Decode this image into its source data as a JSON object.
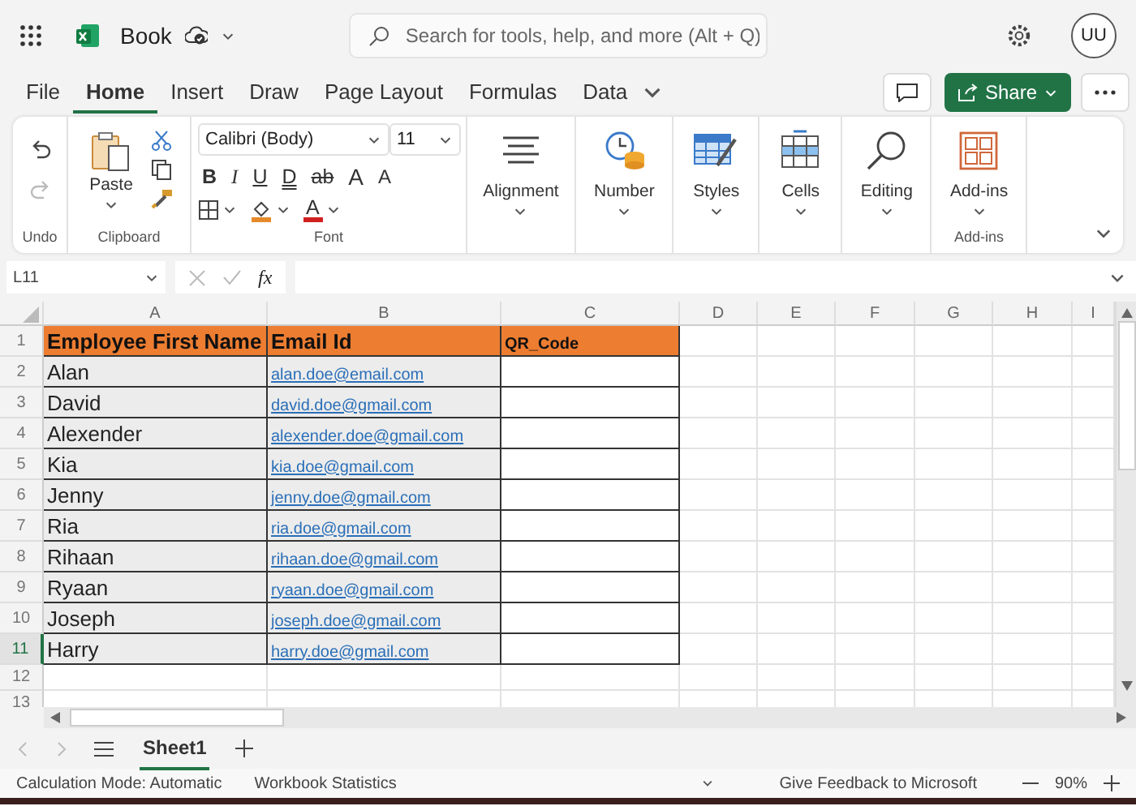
{
  "app_bar": {
    "title": "Book",
    "search": {
      "placeholder": "Search for tools, help, and more (Alt + Q)"
    },
    "avatar": "UU"
  },
  "menu_tabs": [
    {
      "label": "File",
      "selected": false
    },
    {
      "label": "Home",
      "selected": true
    },
    {
      "label": "Insert",
      "selected": false
    },
    {
      "label": "Draw",
      "selected": false
    },
    {
      "label": "Page Layout",
      "selected": false
    },
    {
      "label": "Formulas",
      "selected": false
    },
    {
      "label": "Data",
      "selected": false
    }
  ],
  "share_button": "Share",
  "ribbon": {
    "undo": {
      "label": "Undo",
      "buttons": [
        {
          "kind": "undo",
          "disabled": false
        },
        {
          "kind": "redo",
          "disabled": true
        }
      ]
    },
    "clipboard": {
      "label": "Clipboard",
      "paste": "Paste"
    },
    "font": {
      "label": "Font",
      "family": "Calibri (Body)",
      "size": "11",
      "format_buttons": [
        {
          "kind": "bold",
          "label": "B"
        },
        {
          "kind": "italic",
          "label": "I"
        },
        {
          "kind": "underline",
          "label": "U"
        },
        {
          "kind": "double_underline",
          "label": "D"
        },
        {
          "kind": "strikethrough",
          "label": "ab"
        },
        {
          "kind": "grow",
          "label": "A"
        },
        {
          "kind": "shrink",
          "label": "A"
        }
      ],
      "font_color": "A"
    },
    "commands": [
      {
        "kind": "alignment",
        "label": "Alignment"
      },
      {
        "kind": "number",
        "label": "Number"
      },
      {
        "kind": "styles",
        "label": "Styles"
      },
      {
        "kind": "cells",
        "label": "Cells"
      },
      {
        "kind": "editing",
        "label": "Editing"
      },
      {
        "kind": "addins",
        "label": "Add-ins",
        "group_label": "Add-ins"
      }
    ]
  },
  "formula_bar": {
    "name_box": "L11",
    "function_label": "fx"
  },
  "sheet": {
    "columns": [
      "A",
      "B",
      "C",
      "D",
      "E",
      "F",
      "G",
      "H",
      "I"
    ],
    "rows": [
      {
        "number": "1",
        "selected": false,
        "kind": "header",
        "cells": [
          "Employee First Name",
          "Email Id",
          "QR_Code"
        ]
      },
      {
        "number": "2",
        "selected": false,
        "kind": "data",
        "cells": [
          "Alan",
          "alan.doe@email.com"
        ]
      },
      {
        "number": "3",
        "selected": false,
        "kind": "data",
        "cells": [
          "David",
          "david.doe@gmail.com"
        ]
      },
      {
        "number": "4",
        "selected": false,
        "kind": "data",
        "cells": [
          "Alexender",
          "alexender.doe@gmail.com"
        ]
      },
      {
        "number": "5",
        "selected": false,
        "kind": "data",
        "cells": [
          "Kia",
          "kia.doe@gmail.com"
        ]
      },
      {
        "number": "6",
        "selected": false,
        "kind": "data",
        "cells": [
          "Jenny",
          "jenny.doe@gmail.com"
        ]
      },
      {
        "number": "7",
        "selected": false,
        "kind": "data",
        "cells": [
          "Ria",
          "ria.doe@gmail.com"
        ]
      },
      {
        "number": "8",
        "selected": false,
        "kind": "data",
        "cells": [
          "Rihaan",
          "rihaan.doe@gmail.com"
        ]
      },
      {
        "number": "9",
        "selected": false,
        "kind": "data",
        "cells": [
          "Ryaan",
          "ryaan.doe@gmail.com"
        ]
      },
      {
        "number": "10",
        "selected": false,
        "kind": "data",
        "cells": [
          "Joseph",
          "joseph.doe@gmail.com"
        ]
      },
      {
        "number": "11",
        "selected": true,
        "kind": "data",
        "cells": [
          "Harry",
          "harry.doe@gmail.com"
        ]
      },
      {
        "number": "12",
        "selected": false,
        "kind": "empty"
      },
      {
        "number": "13",
        "selected": false,
        "kind": "empty"
      }
    ]
  },
  "sheet_tabs": [
    {
      "label": "Sheet1",
      "selected": true
    }
  ],
  "status_bar": {
    "calculation": "Calculation Mode: Automatic",
    "statistics": "Workbook Statistics",
    "feedback": "Give Feedback to Microsoft",
    "zoom": "90%"
  }
}
